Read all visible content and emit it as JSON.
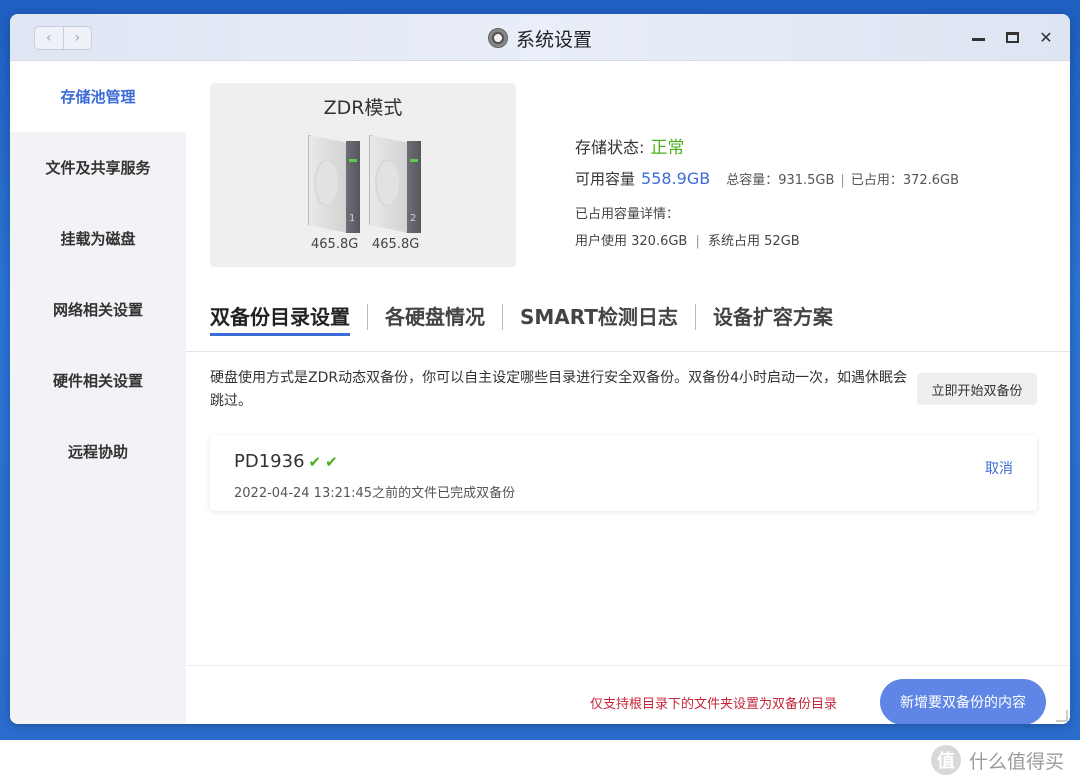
{
  "window": {
    "title": "系统设置"
  },
  "sidebar": {
    "items": [
      {
        "label": "存储池管理",
        "active": true
      },
      {
        "label": "文件及共享服务"
      },
      {
        "label": "挂载为磁盘"
      },
      {
        "label": "网络相关设置"
      },
      {
        "label": "硬件相关设置"
      },
      {
        "label": "远程协助"
      }
    ]
  },
  "storage": {
    "mode_title": "ZDR模式",
    "disks": [
      {
        "num": "1",
        "size": "465.8G"
      },
      {
        "num": "2",
        "size": "465.8G"
      }
    ],
    "status_label": "存储状态:",
    "status_value": "正常",
    "available_label": "可用容量",
    "available_value": "558.9GB",
    "total_text": "总容量：931.5GB",
    "used_text": "已占用：372.6GB",
    "detail_label": "已占用容量详情：",
    "user_usage": "用户使用 320.6GB",
    "system_usage": "系统占用 52GB"
  },
  "tabs": [
    {
      "label": "双备份目录设置",
      "active": true
    },
    {
      "label": "各硬盘情况"
    },
    {
      "label": "SMART检测日志"
    },
    {
      "label": "设备扩容方案"
    }
  ],
  "backup": {
    "description": "硬盘使用方式是ZDR动态双备份，你可以自主设定哪些目录进行安全双备份。双备份4小时启动一次，如遇休眠会跳过。",
    "start_button": "立即开始双备份",
    "item": {
      "name": "PD1936",
      "status_text": "2022-04-24 13:21:45之前的文件已完成双备份",
      "cancel": "取消"
    },
    "note": "仅支持根目录下的文件夹设置为双备份目录",
    "add_button": "新增要双备份的内容"
  },
  "watermark": {
    "text": "什么值得买",
    "badge": "值"
  },
  "colors": {
    "accent": "#3d6cd8",
    "ok": "#4caf1c",
    "warn": "#c4273a",
    "primary_button": "#5f86e6"
  }
}
